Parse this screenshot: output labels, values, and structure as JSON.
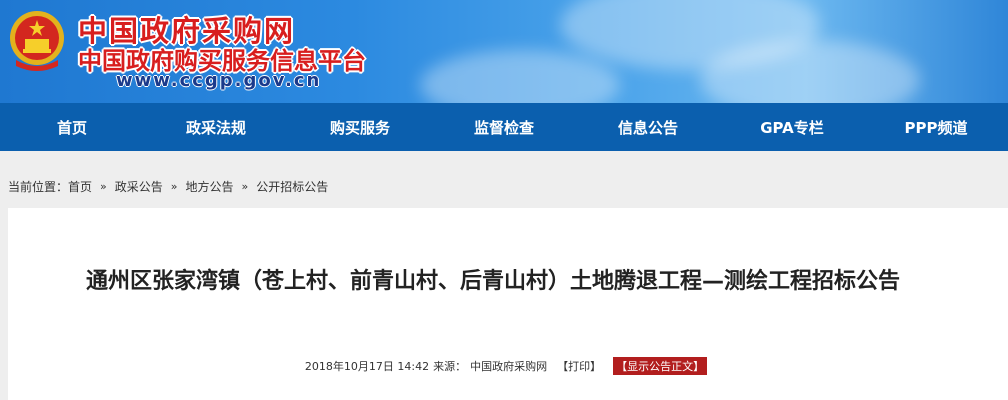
{
  "header": {
    "site_title": "中国政府采购网",
    "site_subtitle": "中国政府购买服务信息平台",
    "site_url": "www.ccgp.gov.cn",
    "colors": {
      "banner": "#2c8ae0",
      "title_red": "#d81e1e",
      "nav": "#0b5fae"
    }
  },
  "nav": {
    "items": [
      {
        "label": "首页"
      },
      {
        "label": "政采法规"
      },
      {
        "label": "购买服务"
      },
      {
        "label": "监督检查"
      },
      {
        "label": "信息公告"
      },
      {
        "label": "GPA专栏"
      },
      {
        "label": "PPP频道"
      }
    ]
  },
  "breadcrumb": {
    "prefix": "当前位置：",
    "items": [
      {
        "label": "首页"
      },
      {
        "label": "政采公告"
      },
      {
        "label": "地方公告"
      },
      {
        "label": "公开招标公告"
      }
    ],
    "separator": "»"
  },
  "article": {
    "title": "通州区张家湾镇（苍上村、前青山村、后青山村）土地腾退工程—测绘工程招标公告",
    "date": "2018年10月17日  14:42",
    "source_label": "来源：",
    "source": "中国政府采购网",
    "print_label": "【打印】",
    "show_body_label": "【显示公告正文】"
  }
}
